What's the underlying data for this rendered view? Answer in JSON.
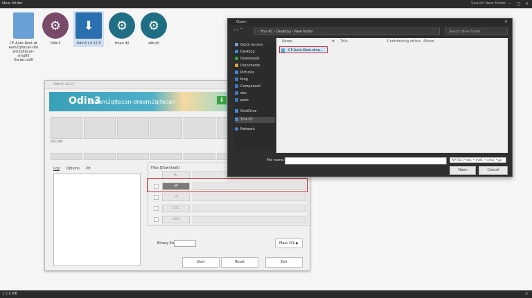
{
  "explorer": {
    "title": "New folder",
    "search_placeholder": "Search New folder",
    "status_left": "1 2.0 MB",
    "status_right": "≡"
  },
  "desktop_icons": [
    {
      "label": "CF-Auto-Root-dream2qltecan-dream2qltecan-smg955w.tar.md5",
      "display": "CF-Auto-Root-dr eam2qltecan-dre am2qltecan-smg95 5w.tar.md5",
      "color": "#6aa0d6"
    },
    {
      "label": "Odin3",
      "color": "#7a4a6a"
    },
    {
      "label": "Odin3 v3.12.5",
      "color": "#2a6fb0"
    },
    {
      "label": "tmax.dll",
      "color": "#1f6e84"
    },
    {
      "label": "zlib.dll",
      "color": "#1f6e84"
    }
  ],
  "odin": {
    "title": "Odin3 v3.12",
    "banner_name": "Odin3",
    "banner_sub": "dream2qltecan-dream2qltecan",
    "id_com": "ID:COM",
    "tabs": [
      "Log",
      "Options",
      "Pit"
    ],
    "files_header": "Files [Download]",
    "rows": [
      "BL",
      "AP",
      "CP",
      "CSC",
      "UMS"
    ],
    "binary_size_label": "Binary Size",
    "mass_dl": "Mass D/L ▶",
    "start": "Start",
    "reset": "Reset",
    "exit": "Exit"
  },
  "open_dialog": {
    "title": "Open",
    "breadcrumb": "›  This PC  ›  Desktop  ›  New folder",
    "search_placeholder": "Search New folder",
    "sidebar": [
      {
        "label": "Quick access",
        "icon": "star-icon",
        "color": "#6aa0d6"
      },
      {
        "label": "Desktop",
        "icon": "desktop-icon",
        "color": "#3b8ad6"
      },
      {
        "label": "Downloads",
        "icon": "download-icon",
        "color": "#3bb04a"
      },
      {
        "label": "Documents",
        "icon": "documents-icon",
        "color": "#d6a23b"
      },
      {
        "label": "Pictures",
        "icon": "pictures-icon",
        "color": "#3b8ad6"
      },
      {
        "label": "blog",
        "icon": "folder-icon",
        "color": "#3b7ac6"
      },
      {
        "label": "Component",
        "icon": "folder-icon",
        "color": "#3b7ac6"
      },
      {
        "label": "doc",
        "icon": "folder-icon",
        "color": "#3b7ac6"
      },
      {
        "label": "pack",
        "icon": "folder-icon",
        "color": "#3b7ac6"
      },
      {
        "label": "OneDrive",
        "icon": "cloud-icon",
        "color": "#3b8ad6"
      },
      {
        "label": "This PC",
        "icon": "pc-icon",
        "color": "#3b8ad6"
      },
      {
        "label": "Network",
        "icon": "network-icon",
        "color": "#3b8ad6"
      }
    ],
    "columns": [
      "Name",
      "#",
      "Title",
      "Contributing artists",
      "Album"
    ],
    "file": "CF-Auto-Root-drea...",
    "filename_label": "File name:",
    "filetype": "AP File (*.tar, *.md5, *.smd, *.gz",
    "open": "Open",
    "cancel": "Cancel"
  }
}
